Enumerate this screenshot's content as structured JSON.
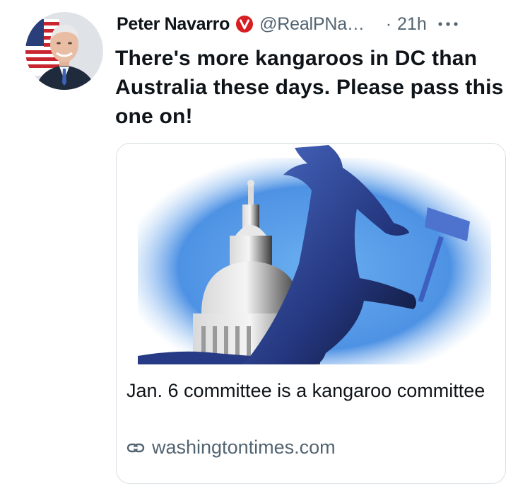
{
  "tweet": {
    "author": {
      "display_name": "Peter Navarro",
      "handle": "@RealPNa…",
      "verified_icon": "verified-badge-icon"
    },
    "separator": "·",
    "time": "21h",
    "more_icon": "more-dots-icon",
    "text": "There's more kangaroos in DC than Australia these days.  Please pass this one on!",
    "card": {
      "title": "Jan. 6 committee is a kangaroo committee",
      "source_icon": "link-icon",
      "source": "washingtontimes.com"
    }
  },
  "colors": {
    "text_primary": "#0f1419",
    "text_secondary": "#536471",
    "badge_red": "#d81e23",
    "card_border": "#d9dfe4",
    "illustration_sky": "#5fa2ea",
    "illustration_kangaroo": "#2b3f8f"
  }
}
